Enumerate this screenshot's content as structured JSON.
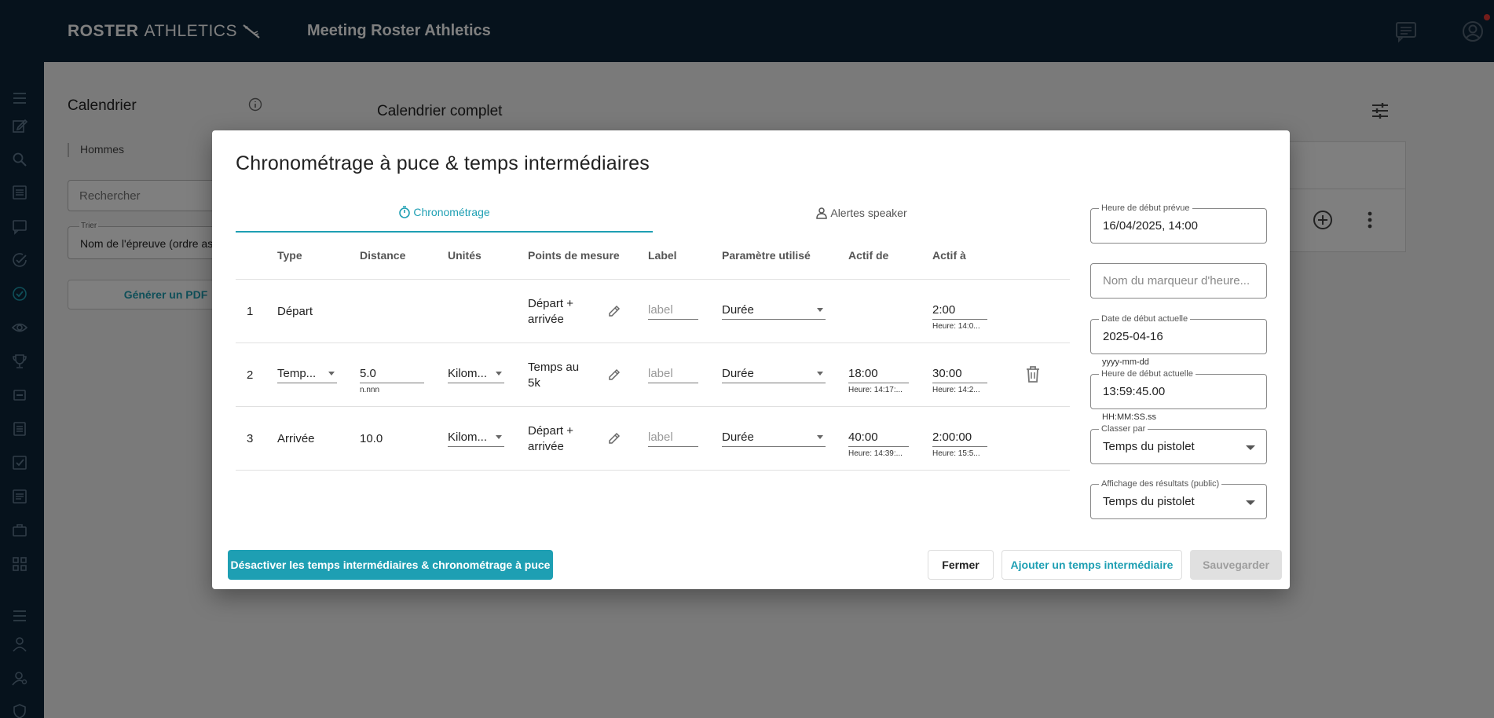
{
  "header": {
    "brand_bold": "ROSTER",
    "brand_light": "ATHLETICS",
    "app_title": "Meeting Roster Athletics"
  },
  "background": {
    "calendar_title": "Calendrier",
    "gender_tab": "Hommes",
    "search_placeholder": "Rechercher",
    "sort_label": "Trier",
    "sort_value": "Nom de l'épreuve (ordre ascendant)",
    "pdf_button": "Générer un PDF",
    "full_calendar_title": "Calendrier complet"
  },
  "modal": {
    "title": "Chronométrage à puce & temps intermédiaires",
    "tabs": [
      {
        "label": "Chronométrage",
        "icon": "timer-icon",
        "active": true
      },
      {
        "label": "Alertes speaker",
        "icon": "person-icon",
        "active": false
      }
    ],
    "columns": [
      "Type",
      "Distance",
      "Unités",
      "Points de mesure",
      "Label",
      "Paramètre utilisé",
      "Actif de",
      "Actif à"
    ],
    "rows": [
      {
        "num": "1",
        "type": "Départ",
        "distance": "",
        "distance_helper": "",
        "units": "",
        "points_line1": "Départ +",
        "points_line2": "arrivée",
        "label_placeholder": "label",
        "param": "Durée",
        "active_from": "",
        "active_from_helper": "",
        "active_to": "2:00",
        "active_to_helper": "Heure: 14:0..."
      },
      {
        "num": "2",
        "type": "Temp...",
        "distance": "5.0",
        "distance_helper": "n.nnn",
        "units": "Kilom...",
        "points_line1": "Temps au",
        "points_line2": "5k",
        "label_placeholder": "label",
        "param": "Durée",
        "active_from": "18:00",
        "active_from_helper": "Heure: 14:17:...",
        "active_to": "30:00",
        "active_to_helper": "Heure: 14:2..."
      },
      {
        "num": "3",
        "type": "Arrivée",
        "distance": "10.0",
        "distance_helper": "",
        "units": "Kilom...",
        "points_line1": "Départ +",
        "points_line2": "arrivée",
        "label_placeholder": "label",
        "param": "Durée",
        "active_from": "40:00",
        "active_from_helper": "Heure: 14:39:...",
        "active_to": "2:00:00",
        "active_to_helper": "Heure: 15:5..."
      }
    ],
    "right_panel": {
      "planned_start_label": "Heure de début prévue",
      "planned_start_value": "16/04/2025, 14:00",
      "marker_placeholder": "Nom du marqueur d'heure...",
      "actual_date_label": "Date de début actuelle",
      "actual_date_value": "2025-04-16",
      "actual_date_helper": "yyyy-mm-dd",
      "actual_time_label": "Heure de début actuelle",
      "actual_time_value": "13:59:45.00",
      "actual_time_helper": "HH:MM:SS.ss",
      "rank_by_label": "Classer par",
      "rank_by_value": "Temps du pistolet",
      "results_display_label": "Affichage des résultats (public)",
      "results_display_value": "Temps du pistolet"
    },
    "buttons": {
      "disable": "Désactiver les temps intermédiaires & chronométrage à puce",
      "close": "Fermer",
      "add_split": "Ajouter un temps intermédiaire",
      "save": "Sauvegarder"
    }
  },
  "colors": {
    "accent": "#1e9fb3",
    "navy": "#0d2438",
    "notification": "#e53935"
  }
}
